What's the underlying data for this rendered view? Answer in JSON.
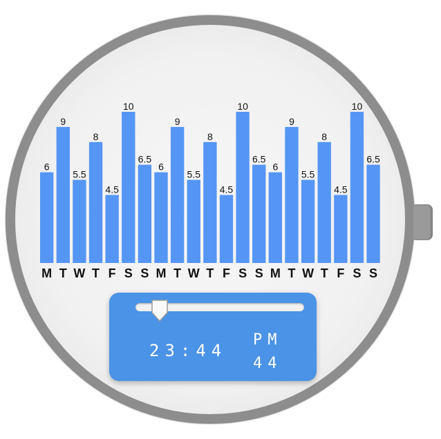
{
  "colors": {
    "bar": "#5596f4",
    "panel": "#4a93e6",
    "case": "#8d8d8d"
  },
  "chart_data": {
    "type": "bar",
    "categories": [
      "M",
      "T",
      "W",
      "T",
      "F",
      "S",
      "S",
      "M",
      "T",
      "W",
      "T",
      "F",
      "S",
      "S",
      "M",
      "T",
      "W",
      "T",
      "F",
      "S",
      "S"
    ],
    "values": [
      6,
      9,
      5.5,
      8,
      4.5,
      10,
      6.5,
      6,
      9,
      5.5,
      8,
      4.5,
      10,
      6.5,
      6,
      9,
      5.5,
      8,
      4.5,
      10,
      6.5
    ],
    "value_labels": [
      "6",
      "9",
      "5.5",
      "8",
      "4.5",
      "10",
      "6.5",
      "6",
      "9",
      "5.5",
      "8",
      "4.5",
      "10",
      "6.5",
      "6",
      "9",
      "5.5",
      "8",
      "4.5",
      "10",
      "6.5"
    ],
    "ylim": [
      0,
      10
    ],
    "grid": false,
    "legend": "none"
  },
  "time_panel": {
    "time": "23:44",
    "ampm": "PM",
    "seconds": "44",
    "slider_value": 0.1
  }
}
